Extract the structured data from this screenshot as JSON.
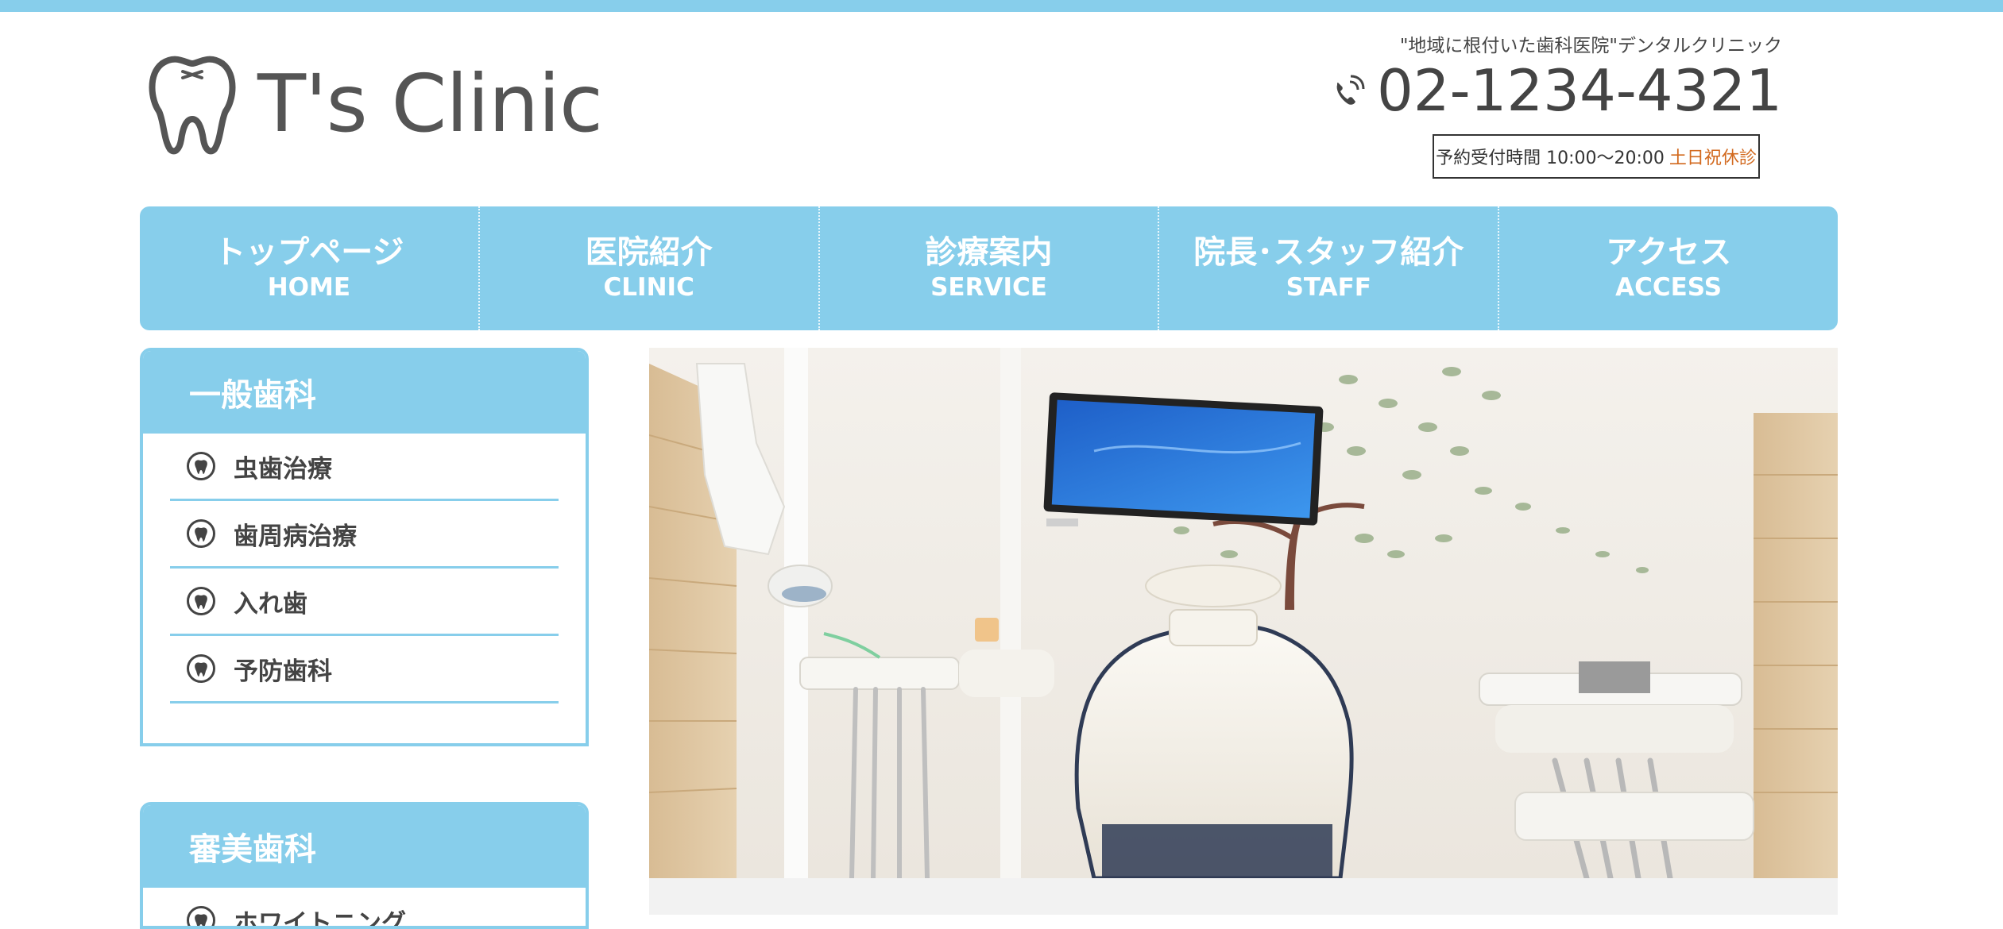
{
  "colors": {
    "accent": "#87ceeb",
    "text": "#444444",
    "closed": "#d2691e"
  },
  "header": {
    "logo_text": "T's Clinic",
    "logo_icon": "tooth-icon",
    "tagline": "\"地域に根付いた歯科医院\"デンタルクリニック",
    "phone_icon": "phone-icon",
    "phone": "02-1234-4321",
    "hours_label": "予約受付時間 10:00〜20:00",
    "hours_closed": "土日祝休診"
  },
  "nav": [
    {
      "jp": "トップページ",
      "en": "HOME"
    },
    {
      "jp": "医院紹介",
      "en": "CLINIC"
    },
    {
      "jp": "診療案内",
      "en": "SERVICE"
    },
    {
      "jp": "院長･スタッフ紹介",
      "en": "STAFF"
    },
    {
      "jp": "アクセス",
      "en": "ACCESS"
    }
  ],
  "sidebar": {
    "general": {
      "title": "一般歯科",
      "items": [
        "虫歯治療",
        "歯周病治療",
        "入れ歯",
        "予防歯科"
      ]
    },
    "cosmetic": {
      "title": "審美歯科",
      "items": [
        "ホワイトニング"
      ]
    }
  },
  "hero": {
    "image": "dental-treatment-room-photo"
  }
}
